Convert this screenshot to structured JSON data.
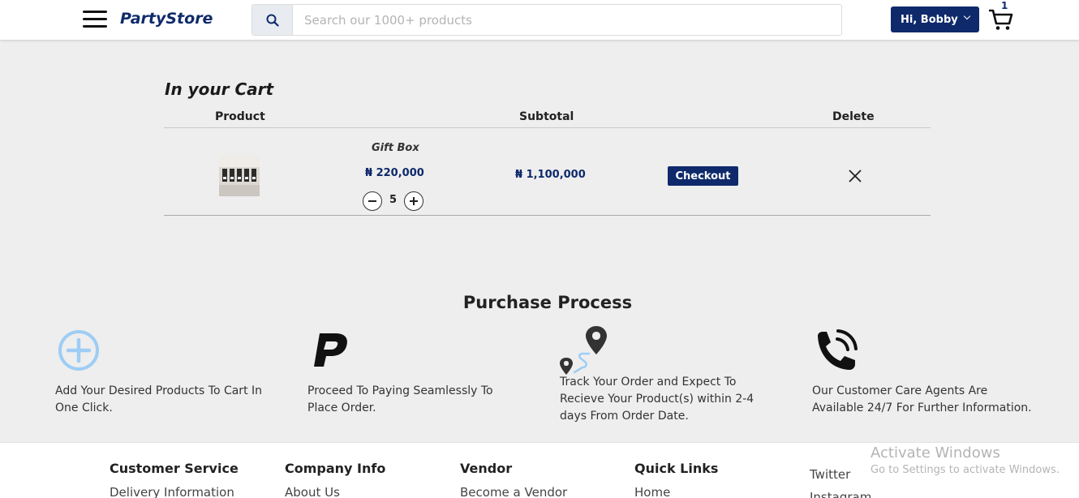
{
  "header": {
    "logo": "PartyStore",
    "search_placeholder": "Search our 1000+ products",
    "user_label": "Hi, Bobby",
    "cart_count": "1"
  },
  "cart": {
    "title": "In your Cart",
    "columns": {
      "product": "Product",
      "subtotal": "Subtotal",
      "delete": "Delete"
    },
    "item": {
      "name": "Gift Box",
      "price": "₦ 220,000",
      "quantity": "5",
      "subtotal": "₦ 1,100,000",
      "checkout_label": "Checkout"
    }
  },
  "process": {
    "title": "Purchase Process",
    "steps": [
      {
        "line1": "Add Your Desired Products To Cart In",
        "line2": "One Click.",
        "icon": "plus-circle-icon"
      },
      {
        "line1": "Proceed To Paying Seamlessly To",
        "line2": "Place Order.",
        "icon": "paypal-icon"
      },
      {
        "line1": "Track Your Order and Expect To",
        "line2": "Recieve Your Product(s) within 2-4",
        "line3": "days From Order Date.",
        "icon": "route-map-icon"
      },
      {
        "line1": "Our Customer Care Agents Are",
        "line2": "Available 24/7 For Further Information.",
        "icon": "phone-call-icon"
      }
    ]
  },
  "footer": {
    "columns": [
      {
        "heading": "Customer Service",
        "link": "Delivery Information"
      },
      {
        "heading": "Company Info",
        "link": "About Us"
      },
      {
        "heading": "Vendor",
        "link": "Become a Vendor"
      },
      {
        "heading": "Quick Links",
        "link": "Home"
      }
    ],
    "social": [
      "Twitter",
      "Instagram"
    ]
  },
  "watermark": {
    "line1": "Activate Windows",
    "line2": "Go to Settings to activate Windows."
  },
  "colors": {
    "brand": "#0f2a6b",
    "icon_light_blue": "#9ecdf5"
  }
}
